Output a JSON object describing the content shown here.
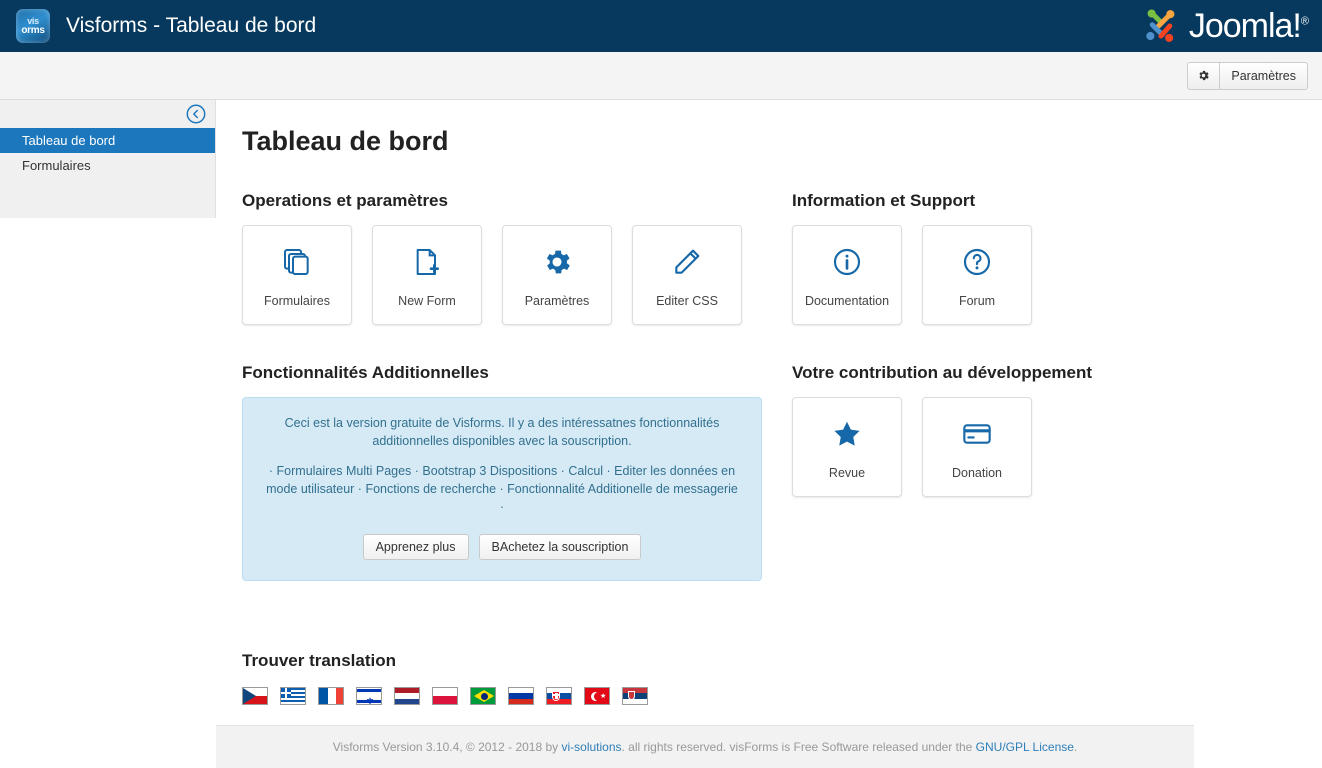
{
  "header": {
    "app_title": "Visforms - Tableau de bord",
    "logo_line1": "vis",
    "logo_line2": "orms",
    "brand_name": "Joomla!",
    "brand_sup": "®"
  },
  "toolbar": {
    "gear_icon": "gear-icon",
    "settings_label": "Paramètres"
  },
  "sidebar": {
    "collapse_icon": "arrow-circle-left-icon",
    "items": [
      {
        "label": "Tableau de bord",
        "active": true
      },
      {
        "label": "Formulaires",
        "active": false
      }
    ]
  },
  "main": {
    "page_title": "Tableau de bord",
    "sections": {
      "operations": {
        "title": "Operations et paramètres",
        "cards": [
          {
            "label": "Formulaires",
            "icon": "copy-stack-icon"
          },
          {
            "label": "New Form",
            "icon": "file-plus-icon"
          },
          {
            "label": "Paramètres",
            "icon": "gear-icon"
          },
          {
            "label": "Editer CSS",
            "icon": "pencil-icon"
          }
        ]
      },
      "support": {
        "title": "Information et Support",
        "cards": [
          {
            "label": "Documentation",
            "icon": "info-circle-icon"
          },
          {
            "label": "Forum",
            "icon": "question-circle-icon"
          }
        ]
      },
      "additional": {
        "title": "Fonctionnalités Additionnelles",
        "intro": "Ceci est la version gratuite de Visforms. Il y a des intéressatnes fonctionnalités additionnelles disponibles avec la souscription.",
        "features": "· Formulaires Multi Pages · Bootstrap 3 Dispositions · Calcul · Editer les données en mode utilisateur · Fonctions de recherche · Fonctionnalité Additionelle de messagerie ·",
        "learn_more_label": "Apprenez plus",
        "buy_label": "BAchetez la souscription"
      },
      "contribution": {
        "title": "Votre contribution au développement",
        "cards": [
          {
            "label": "Revue",
            "icon": "star-icon"
          },
          {
            "label": "Donation",
            "icon": "credit-card-icon"
          }
        ]
      },
      "translation": {
        "title": "Trouver translation",
        "flags": [
          {
            "name": "czech-flag"
          },
          {
            "name": "greek-flag"
          },
          {
            "name": "french-flag"
          },
          {
            "name": "israeli-flag"
          },
          {
            "name": "dutch-flag"
          },
          {
            "name": "polish-flag"
          },
          {
            "name": "brazilian-flag"
          },
          {
            "name": "russian-flag"
          },
          {
            "name": "slovak-flag"
          },
          {
            "name": "turkish-flag"
          },
          {
            "name": "serbian-flag"
          }
        ]
      }
    }
  },
  "footer": {
    "text_before": "Visforms Version 3.10.4, © 2012 - 2018 by ",
    "vendor_link": "vi-solutions",
    "text_middle": ". all rights reserved. visForms is Free Software released under the ",
    "license_link": "GNU/GPL License",
    "text_after": "."
  }
}
